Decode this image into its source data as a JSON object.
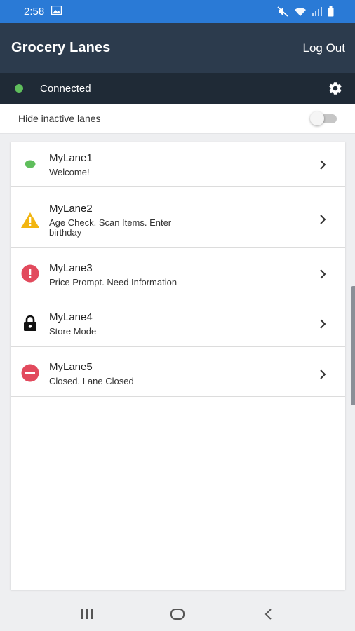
{
  "status_bar": {
    "time": "2:58",
    "icons": [
      "gallery-icon",
      "mute-icon",
      "wifi-icon",
      "signal-icon",
      "battery-icon"
    ]
  },
  "header": {
    "title": "Grocery Lanes",
    "logout_label": "Log Out"
  },
  "connection": {
    "status_text": "Connected",
    "status_color": "#5fbe5c",
    "settings_icon": "gear-icon"
  },
  "filter": {
    "hide_inactive_label": "Hide inactive lanes",
    "hide_inactive_enabled": false
  },
  "lanes": [
    {
      "name": "MyLane1",
      "status": "Welcome!",
      "icon": "green-dot-icon",
      "color": "#5fbe5c"
    },
    {
      "name": "MyLane2",
      "status": "Age Check. Scan Items. Enter birthday",
      "icon": "warning-icon",
      "color": "#f2b511"
    },
    {
      "name": "MyLane3",
      "status": "Price Prompt. Need Information",
      "icon": "error-icon",
      "color": "#e24a5d"
    },
    {
      "name": "MyLane4",
      "status": "Store Mode",
      "icon": "lock-icon",
      "color": "#111111"
    },
    {
      "name": "MyLane5",
      "status": "Closed. Lane Closed",
      "icon": "closed-icon",
      "color": "#e24a5d"
    }
  ],
  "nav": {
    "icons": [
      "recent-apps-icon",
      "home-icon",
      "back-icon"
    ]
  }
}
